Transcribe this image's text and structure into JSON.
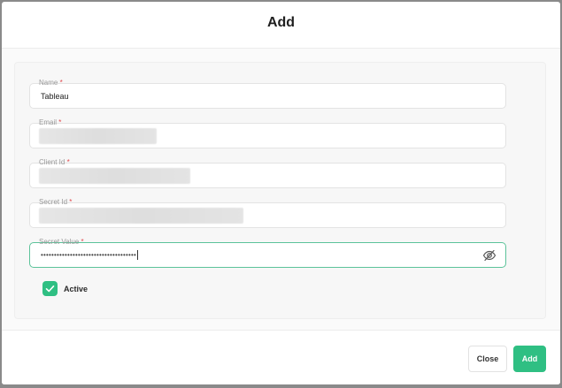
{
  "modal": {
    "title": "Add"
  },
  "form": {
    "fields": [
      {
        "label": "Name",
        "required_mark": "*",
        "value": "Tableau"
      },
      {
        "label": "Email",
        "required_mark": "*",
        "value": ""
      },
      {
        "label": "Client Id",
        "required_mark": "*",
        "value": ""
      },
      {
        "label": "Secret Id",
        "required_mark": "*",
        "value": ""
      },
      {
        "label": "Secret Value",
        "required_mark": "*",
        "masked_value": "••••••••••••••••••••••••••••••••••••"
      }
    ],
    "active": {
      "label": "Active",
      "checked": true
    }
  },
  "footer": {
    "close_label": "Close",
    "add_label": "Add"
  },
  "colors": {
    "accent": "#2fbf83",
    "focus_border": "#5cc39a",
    "required": "#e0474c"
  },
  "icons": {
    "toggle_visibility": "eye-slash-icon",
    "checkbox": "check-icon"
  }
}
